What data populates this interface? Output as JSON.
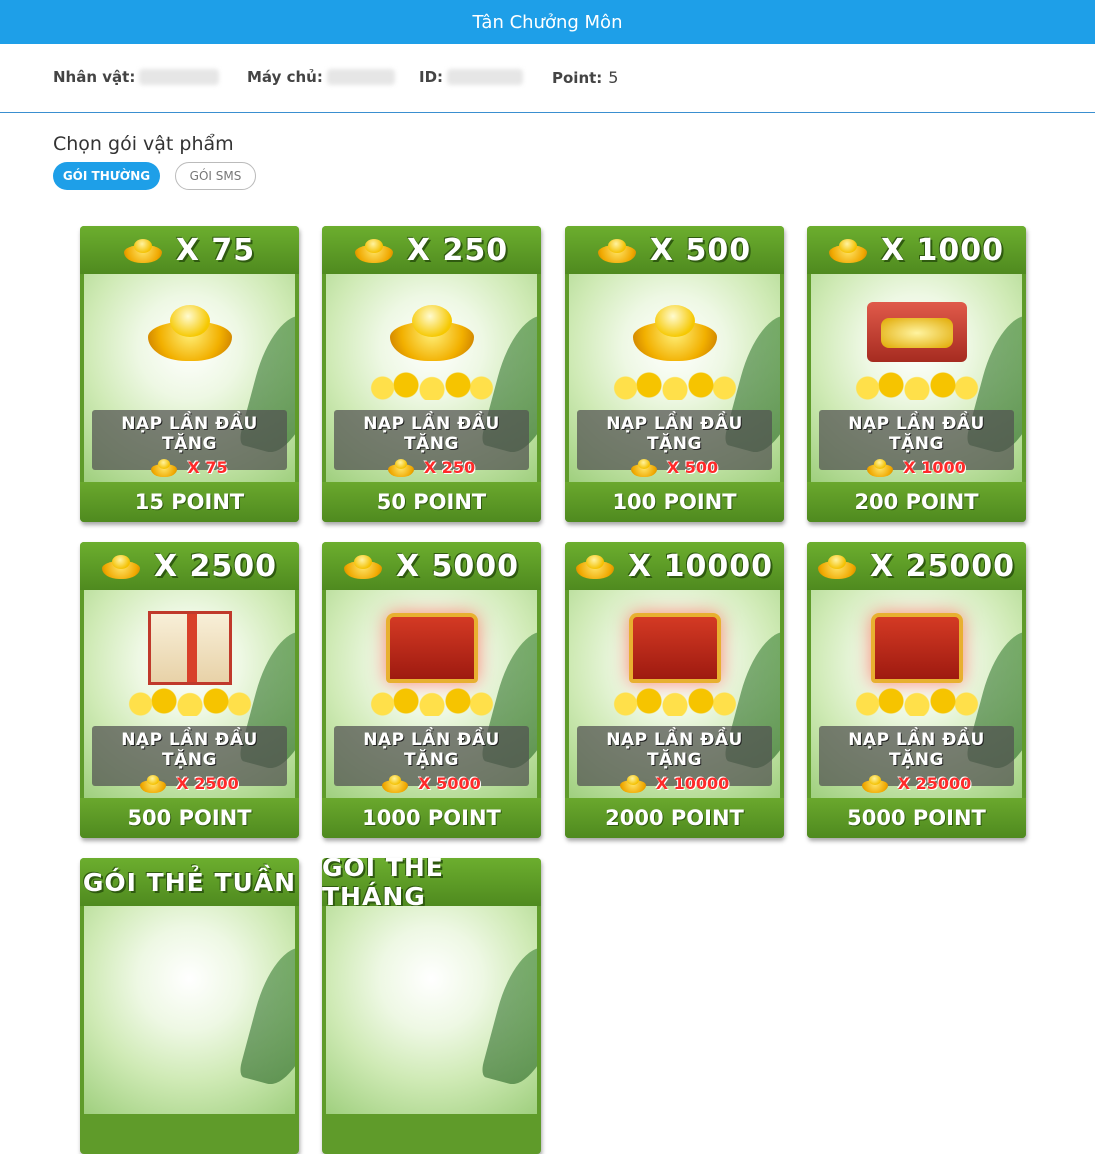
{
  "header": {
    "title": "Tân Chưởng Môn"
  },
  "info": {
    "character_label": "Nhân vật:",
    "server_label": "Máy chủ:",
    "id_label": "ID:",
    "point_label": "Point:",
    "point_value": "5"
  },
  "section": {
    "title": "Chọn gói vật phẩm"
  },
  "tabs": [
    {
      "label": "GÓI THƯỜNG",
      "active": true
    },
    {
      "label": "GÓI SMS",
      "active": false
    }
  ],
  "cards": [
    {
      "amount": "X 75",
      "promo": "NẠP LẦN ĐẦU TẶNG",
      "bonus": "X 75",
      "price": "15 POINT",
      "art": "ingot"
    },
    {
      "amount": "X 250",
      "promo": "NẠP LẦN ĐẦU TẶNG",
      "bonus": "X 250",
      "price": "50 POINT",
      "art": "ingot-pile"
    },
    {
      "amount": "X 500",
      "promo": "NẠP LẦN ĐẦU TẶNG",
      "bonus": "X 500",
      "price": "100 POINT",
      "art": "ingot-pile"
    },
    {
      "amount": "X 1000",
      "promo": "NẠP LẦN ĐẦU TẶNG",
      "bonus": "X 1000",
      "price": "200 POINT",
      "art": "red-box"
    },
    {
      "amount": "X 2500",
      "promo": "NẠP LẦN ĐẦU TẶNG",
      "bonus": "X 2500",
      "price": "500 POINT",
      "art": "gift-box"
    },
    {
      "amount": "X 5000",
      "promo": "NẠP LẦN ĐẦU TẶNG",
      "bonus": "X 5000",
      "price": "1000 POINT",
      "art": "chest"
    },
    {
      "amount": "X 10000",
      "promo": "NẠP LẦN ĐẦU TẶNG",
      "bonus": "X 10000",
      "price": "2000 POINT",
      "art": "chest"
    },
    {
      "amount": "X 25000",
      "promo": "NẠP LẦN ĐẦU TẶNG",
      "bonus": "X 25000",
      "price": "5000 POINT",
      "art": "chest"
    }
  ],
  "special_cards": [
    {
      "title": "GÓI THẺ TUẦN"
    },
    {
      "title": "GÓI THẺ THÁNG"
    }
  ],
  "colors": {
    "accent": "#1e9fe8",
    "card_green": "#5f9b2a",
    "bonus_red": "#ff2a2a"
  }
}
